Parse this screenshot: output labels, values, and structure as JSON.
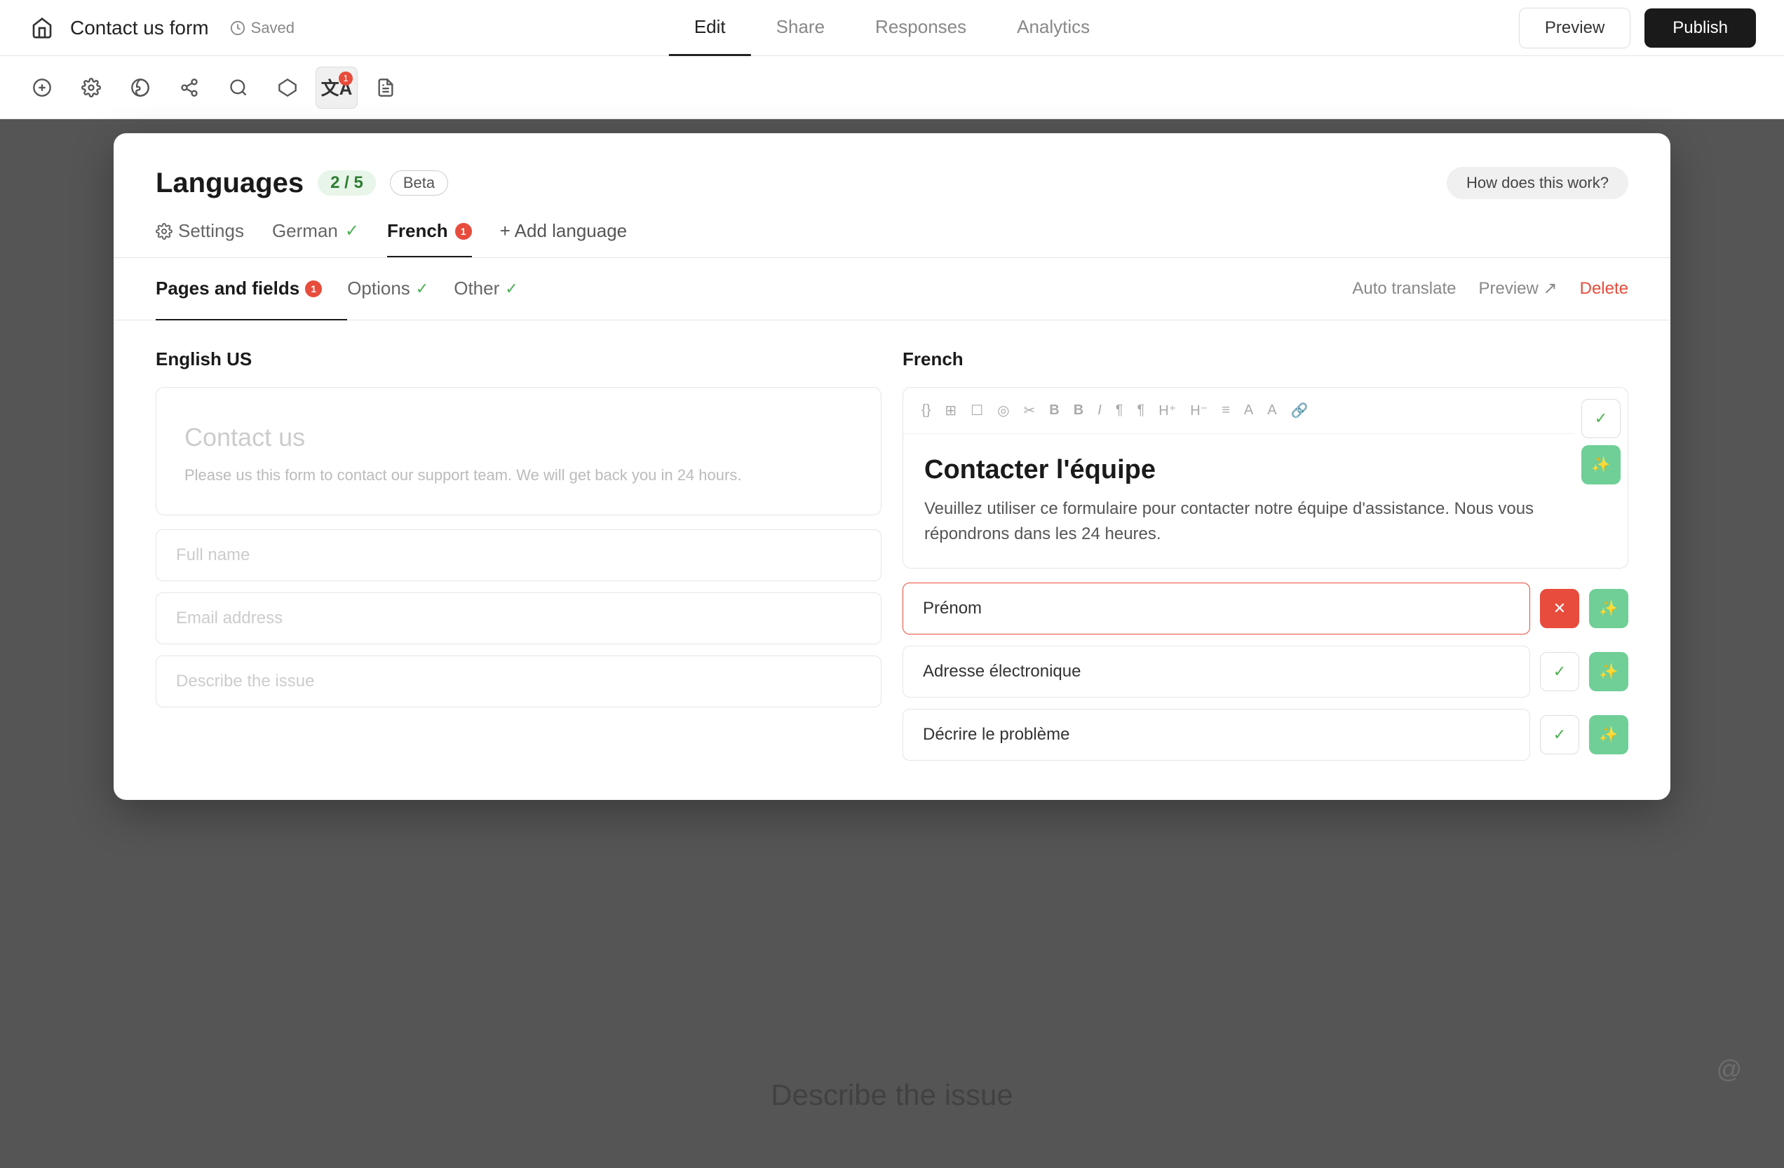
{
  "app": {
    "title": "Contact us form",
    "saved_label": "Saved"
  },
  "nav": {
    "tabs": [
      {
        "label": "Edit",
        "active": true
      },
      {
        "label": "Share",
        "active": false
      },
      {
        "label": "Responses",
        "active": false
      },
      {
        "label": "Analytics",
        "active": false
      }
    ],
    "preview_label": "Preview",
    "publish_label": "Publish"
  },
  "toolbar": {
    "icons": [
      {
        "name": "add-icon",
        "symbol": "+"
      },
      {
        "name": "settings-icon",
        "symbol": "⚙"
      },
      {
        "name": "theme-icon",
        "symbol": "🎨"
      },
      {
        "name": "share-icon",
        "symbol": "↗"
      },
      {
        "name": "search-icon",
        "symbol": "⌕"
      },
      {
        "name": "connect-icon",
        "symbol": "⬡"
      },
      {
        "name": "translate-icon",
        "symbol": "文A",
        "active": true,
        "badge": "1"
      },
      {
        "name": "document-icon",
        "symbol": "📄"
      }
    ]
  },
  "modal": {
    "title": "Languages",
    "lang_count": "2 / 5",
    "beta_label": "Beta",
    "how_does_label": "How does this work?",
    "lang_tabs": [
      {
        "label": "Settings",
        "type": "settings"
      },
      {
        "label": "German",
        "check": true
      },
      {
        "label": "French",
        "active": true,
        "badge": "1"
      },
      {
        "label": "+ Add language",
        "type": "add"
      }
    ],
    "sub_tabs": [
      {
        "label": "Pages and fields",
        "active": true,
        "badge": "1"
      },
      {
        "label": "Options",
        "check": true
      },
      {
        "label": "Other",
        "check": true
      }
    ],
    "sub_actions": {
      "auto_translate": "Auto translate",
      "preview": "Preview ↗",
      "delete": "Delete"
    },
    "en_col_header": "English US",
    "fr_col_header": "French",
    "en_form": {
      "title": "Contact us",
      "description": "Please us this form to contact our support team. We will get back you in 24 hours.",
      "fields": [
        "Full name",
        "Email address",
        "Describe the issue"
      ]
    },
    "fr_form": {
      "title": "Contacter l'équipe",
      "description": "Veuillez utiliser ce formulaire pour contacter notre équipe d'assistance. Nous vous répondrons dans les 24 heures.",
      "fields": [
        {
          "value": "Prénom",
          "error": true
        },
        {
          "value": "Adresse électronique",
          "ok": true
        },
        {
          "value": "Décrire le problème",
          "ok": true
        }
      ]
    },
    "editor_tools": [
      "{}",
      "⊞",
      "☐",
      "◎",
      "✂",
      "B",
      "B",
      "I",
      "¶",
      "¶",
      "H",
      "H",
      "≡",
      "A",
      "A",
      "🔗"
    ]
  },
  "bg": {
    "describe_label": "Describe the issue"
  }
}
